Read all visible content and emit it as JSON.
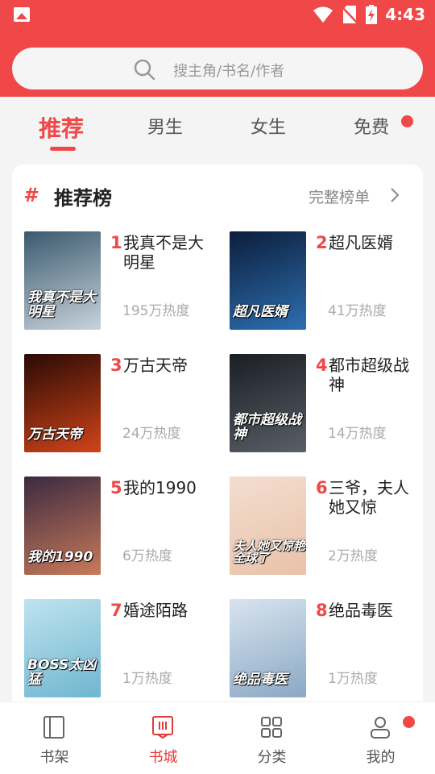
{
  "status": {
    "time": "4:43"
  },
  "search": {
    "placeholder": "搜主角/书名/作者"
  },
  "tabs": [
    {
      "label": "推荐",
      "active": true
    },
    {
      "label": "男生"
    },
    {
      "label": "女生"
    },
    {
      "label": "免费",
      "badge": true
    }
  ],
  "ranking": {
    "title": "推荐榜",
    "more": "完整榜单",
    "books": [
      {
        "rank": "1",
        "name": "我真不是大明星",
        "heat": "195万热度",
        "cover_text": "我真不是大明星",
        "cover_colors": [
          "#3a5a6e",
          "#c9d3dc"
        ]
      },
      {
        "rank": "2",
        "name": "超凡医婿",
        "heat": "41万热度",
        "cover_text": "超凡医婿",
        "cover_colors": [
          "#0c1e3c",
          "#2d6fb0"
        ]
      },
      {
        "rank": "3",
        "name": "万古天帝",
        "heat": "24万热度",
        "cover_text": "万古天帝",
        "cover_colors": [
          "#2a0a05",
          "#d0441a"
        ]
      },
      {
        "rank": "4",
        "name": "都市超级战神",
        "heat": "14万热度",
        "cover_text": "都市超级战神",
        "cover_colors": [
          "#1a1d24",
          "#5a6068"
        ]
      },
      {
        "rank": "5",
        "name": "我的1990",
        "heat": "6万热度",
        "cover_text": "我的1990",
        "cover_colors": [
          "#3b2a40",
          "#c97a5a"
        ]
      },
      {
        "rank": "6",
        "name": "三爷，夫人她又惊",
        "heat": "2万热度",
        "cover_text": "夫人她又惊艳全球了",
        "cover_colors": [
          "#f3ddd0",
          "#e9c2a8"
        ]
      },
      {
        "rank": "7",
        "name": "婚途陌路",
        "heat": "1万热度",
        "cover_text": "BOSS太凶猛",
        "cover_colors": [
          "#bfe3ee",
          "#6fb6d0"
        ]
      },
      {
        "rank": "8",
        "name": "绝品毒医",
        "heat": "1万热度",
        "cover_text": "绝品毒医",
        "cover_colors": [
          "#d8e4ef",
          "#8aa8c4"
        ]
      }
    ]
  },
  "nav": [
    {
      "label": "书架",
      "icon": "bookshelf-icon"
    },
    {
      "label": "书城",
      "icon": "bookstore-icon",
      "active": true
    },
    {
      "label": "分类",
      "icon": "category-icon"
    },
    {
      "label": "我的",
      "icon": "profile-icon",
      "badge": true
    }
  ],
  "colors": {
    "accent": "#f04848",
    "text": "#222222",
    "muted": "#aaaaaa"
  }
}
